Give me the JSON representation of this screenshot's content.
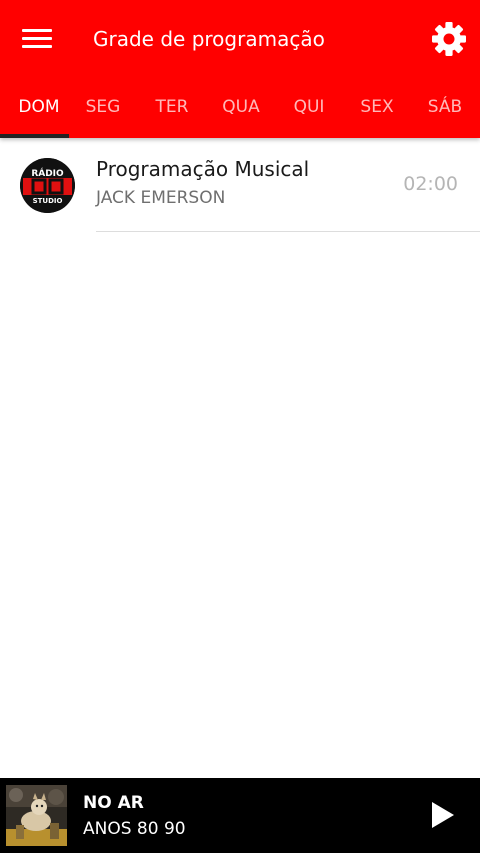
{
  "header": {
    "title": "Grade de programação",
    "menu_icon": "hamburger-menu-icon",
    "settings_icon": "gear-icon",
    "background_color": "#ff0000"
  },
  "tabs": [
    {
      "label": "DOM",
      "active": true
    },
    {
      "label": "SEG",
      "active": false
    },
    {
      "label": "TER",
      "active": false
    },
    {
      "label": "QUA",
      "active": false
    },
    {
      "label": "QUI",
      "active": false
    },
    {
      "label": "SEX",
      "active": false
    },
    {
      "label": "SÁB",
      "active": false
    }
  ],
  "schedule": [
    {
      "title": "Programação Musical",
      "host": "JACK EMERSON",
      "time": "02:00",
      "logo": {
        "top_text": "RÁDIO",
        "bottom_text": "STUDIO"
      }
    }
  ],
  "player": {
    "status": "NO AR",
    "track": "ANOS 80 90",
    "play_icon": "play-icon"
  }
}
